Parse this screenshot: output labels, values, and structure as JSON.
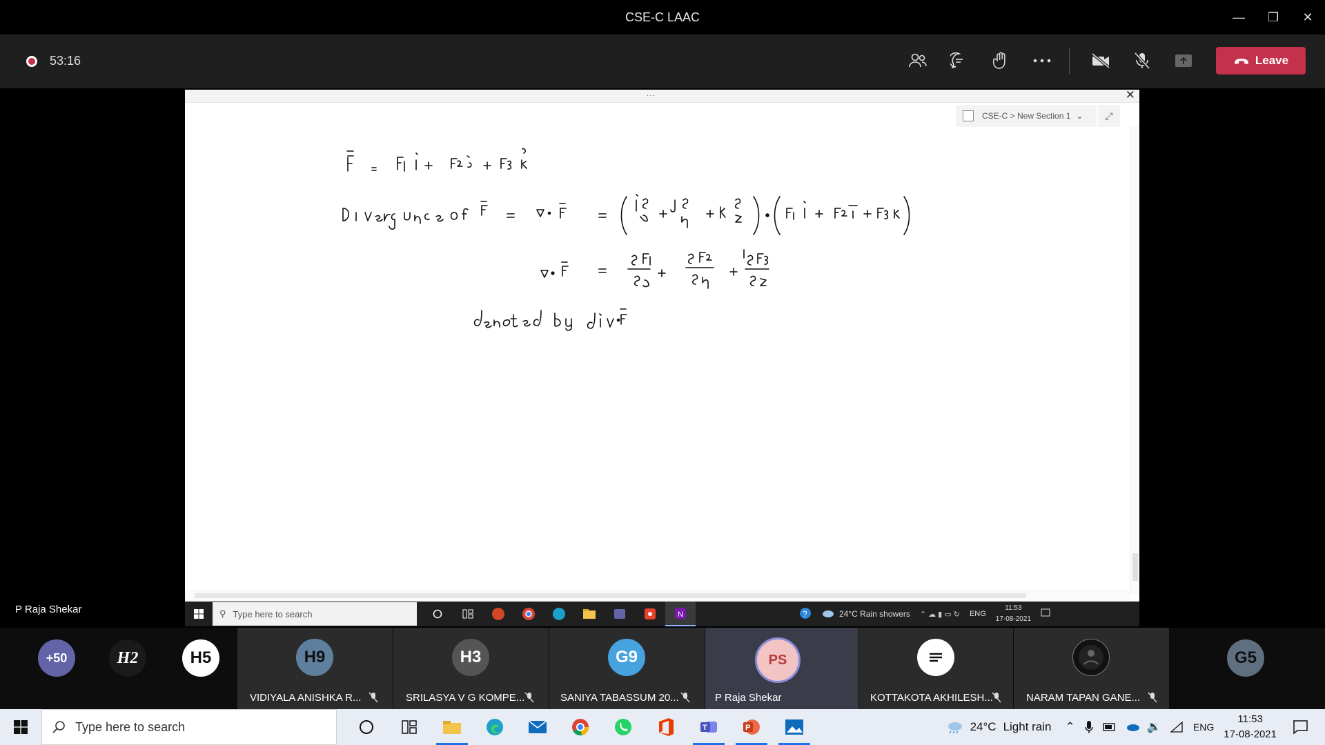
{
  "window": {
    "title": "CSE-C LAAC"
  },
  "toolbar": {
    "recording_time": "53:16",
    "leave_label": "Leave"
  },
  "shared": {
    "section_path": "CSE-C > New Section 1",
    "presenter": "P Raja Shekar",
    "inner_taskbar": {
      "search_placeholder": "Type here to search",
      "weather": "24°C  Rain showers",
      "lang": "ENG",
      "time": "11:53",
      "date": "17-08-2021"
    }
  },
  "participants": [
    {
      "initials": "+50",
      "color": "#6264a7",
      "name": ""
    },
    {
      "initials": "H2",
      "color": "#1a1a1a",
      "name": ""
    },
    {
      "initials": "H5",
      "color": "#ffffff",
      "name": ""
    },
    {
      "initials": "H9",
      "color": "#5f7f9f",
      "name": "VIDIYALA ANISHKA R..."
    },
    {
      "initials": "H3",
      "color": "#555555",
      "name": "SRILASYA V G KOMPE..."
    },
    {
      "initials": "G9",
      "color": "#46a3e0",
      "name": "SANIYA TABASSUM 20..."
    },
    {
      "initials": "PS",
      "color": "#f3c4c4",
      "name": "P Raja Shekar"
    },
    {
      "initials": "",
      "color": "#ffffff",
      "name": "KOTTAKOTA AKHILESH..."
    },
    {
      "initials": "",
      "color": "#111111",
      "name": "NARAM TAPAN GANE..."
    },
    {
      "initials": "G5",
      "color": "#5f6f7f",
      "name": ""
    }
  ],
  "taskbar": {
    "search_placeholder": "Type here to search",
    "weather_temp": "24°C",
    "weather_desc": "Light rain",
    "lang": "ENG",
    "time": "11:53",
    "date": "17-08-2021"
  }
}
